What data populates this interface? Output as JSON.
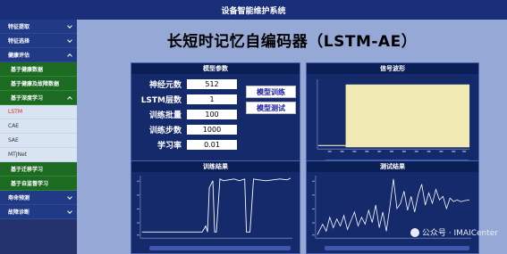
{
  "app": {
    "title": "设备智能维护系统"
  },
  "sidebar": {
    "items": [
      {
        "label": "特征提取",
        "style": "section",
        "chevron": "down"
      },
      {
        "label": "特征选择",
        "style": "section",
        "chevron": "down"
      },
      {
        "label": "健康评估",
        "style": "section",
        "chevron": "up"
      },
      {
        "label": "基于健康数据",
        "style": "green"
      },
      {
        "label": "基于健康及故障数据",
        "style": "green"
      },
      {
        "label": "基于深度学习",
        "style": "green",
        "chevron": "up"
      },
      {
        "label": "LSTM",
        "style": "light",
        "active": true
      },
      {
        "label": "CAE",
        "style": "light"
      },
      {
        "label": "SAE",
        "style": "light"
      },
      {
        "label": "MTJNet",
        "style": "light"
      },
      {
        "label": "基于迁移学习",
        "style": "green"
      },
      {
        "label": "基于自监督学习",
        "style": "green"
      },
      {
        "label": "寿命预测",
        "style": "section",
        "chevron": "down"
      },
      {
        "label": "故障诊断",
        "style": "section",
        "chevron": "down"
      }
    ]
  },
  "main": {
    "title": "长短时记忆自编码器（LSTM-AE）",
    "params_panel": {
      "title": "模型参数",
      "fields": [
        {
          "label": "神经元数",
          "value": "512"
        },
        {
          "label": "LSTM层数",
          "value": "1"
        },
        {
          "label": "训练批量",
          "value": "100"
        },
        {
          "label": "训练步数",
          "value": "1000"
        },
        {
          "label": "学习率",
          "value": "0.01"
        }
      ],
      "buttons": {
        "train": "模型训练",
        "test": "模型测试"
      }
    },
    "wave_panel": {
      "title": "信号波形"
    },
    "train_panel": {
      "title": "训练结果"
    },
    "test_panel": {
      "title": "测试结果"
    }
  },
  "watermark": {
    "text": "公众号 · IMAICenter"
  },
  "colors": {
    "main_bg": "#96a9d6",
    "panel_bg": "#142a6b",
    "sidebar_green": "#1d6b23",
    "signal_fill": "#f2eab4"
  }
}
